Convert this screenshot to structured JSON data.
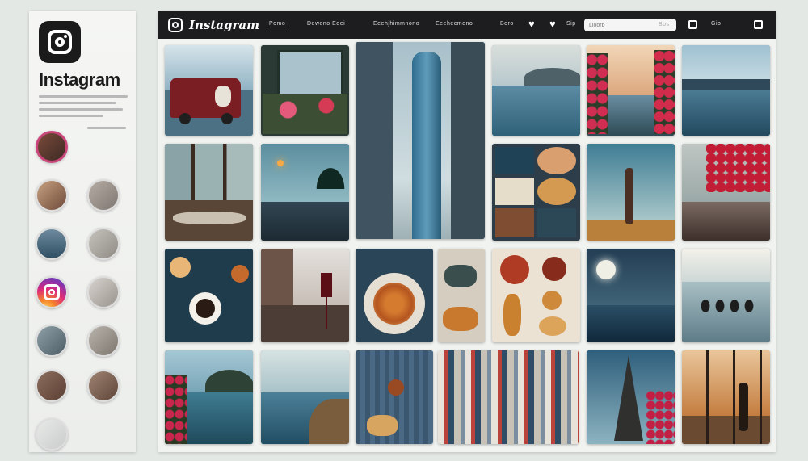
{
  "sidebar": {
    "brand": "Instagram"
  },
  "topbar": {
    "brand": "Instagram",
    "links": [
      "Pomo",
      "Dewono Eoei",
      "Eeehjhimmnono",
      "Eeehecmeno"
    ],
    "items": [
      "Boro",
      "Sip",
      "Gio"
    ],
    "search_placeholder": "Lioorb",
    "search_button": "Bos"
  },
  "colors": {
    "topbar": "#1d1d1f",
    "accent": "#c9467a",
    "background": "#e4e8e5"
  },
  "icons": [
    "instagram-logo-icon",
    "heart-icon",
    "plus-square-icon",
    "menu-square-icon"
  ]
}
